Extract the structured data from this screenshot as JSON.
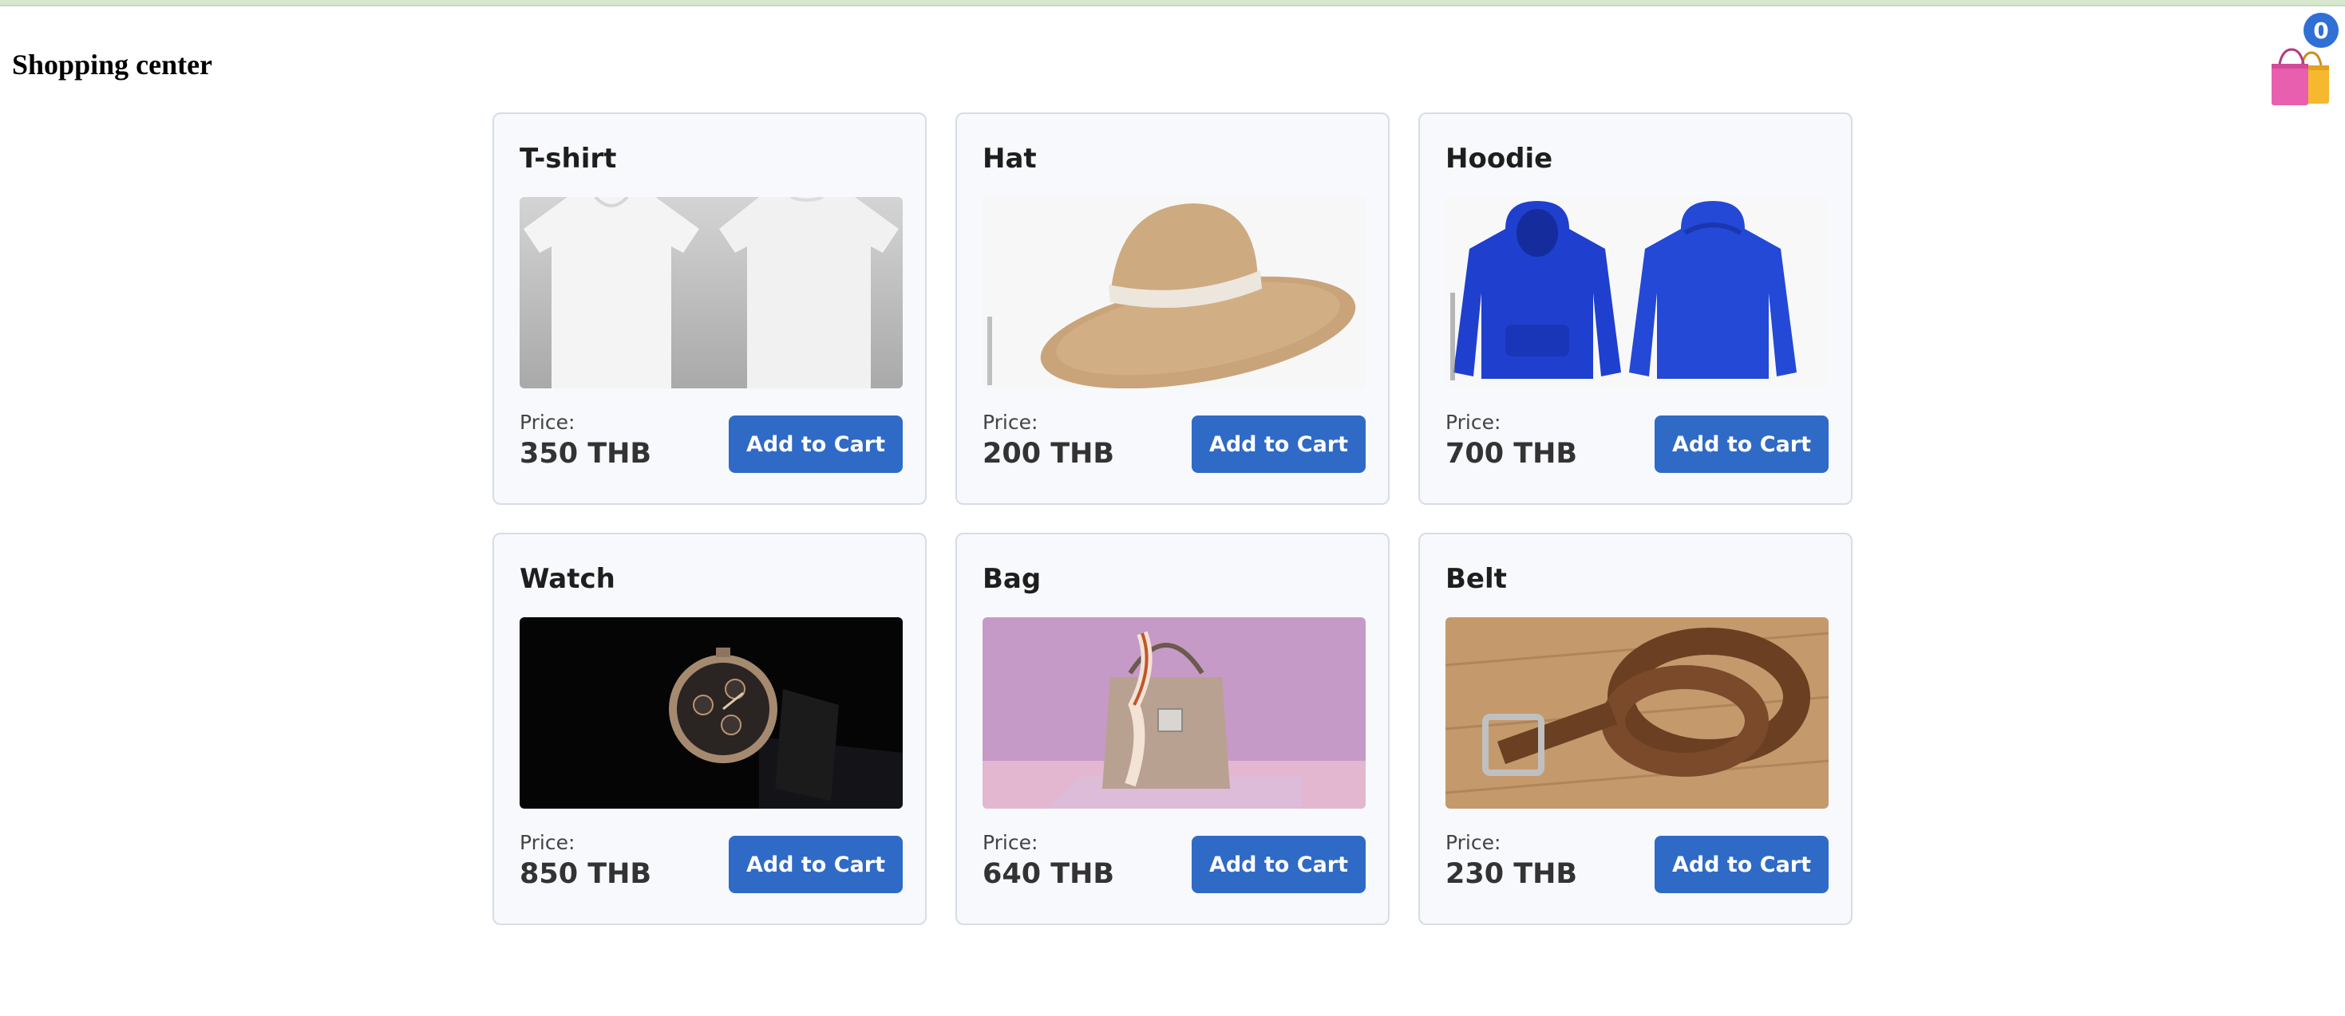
{
  "header": {
    "title": "Shopping center"
  },
  "cart": {
    "count": "0",
    "icon": "shopping-bags-icon"
  },
  "products": [
    {
      "name": "T-shirt",
      "price_label": "Price:",
      "price": "350 THB",
      "button_label": "Add to Cart",
      "image": "white-tshirt"
    },
    {
      "name": "Hat",
      "price_label": "Price:",
      "price": "200 THB",
      "button_label": "Add to Cart",
      "image": "straw-hat"
    },
    {
      "name": "Hoodie",
      "price_label": "Price:",
      "price": "700 THB",
      "button_label": "Add to Cart",
      "image": "blue-hoodie"
    },
    {
      "name": "Watch",
      "price_label": "Price:",
      "price": "850 THB",
      "button_label": "Add to Cart",
      "image": "wrist-watch"
    },
    {
      "name": "Bag",
      "price_label": "Price:",
      "price": "640 THB",
      "button_label": "Add to Cart",
      "image": "handbag"
    },
    {
      "name": "Belt",
      "price_label": "Price:",
      "price": "230 THB",
      "button_label": "Add to Cart",
      "image": "leather-belt"
    }
  ],
  "colors": {
    "accent": "#2f6ac7",
    "badge": "#2f6fd6",
    "card_background": "#f7f9fc"
  }
}
